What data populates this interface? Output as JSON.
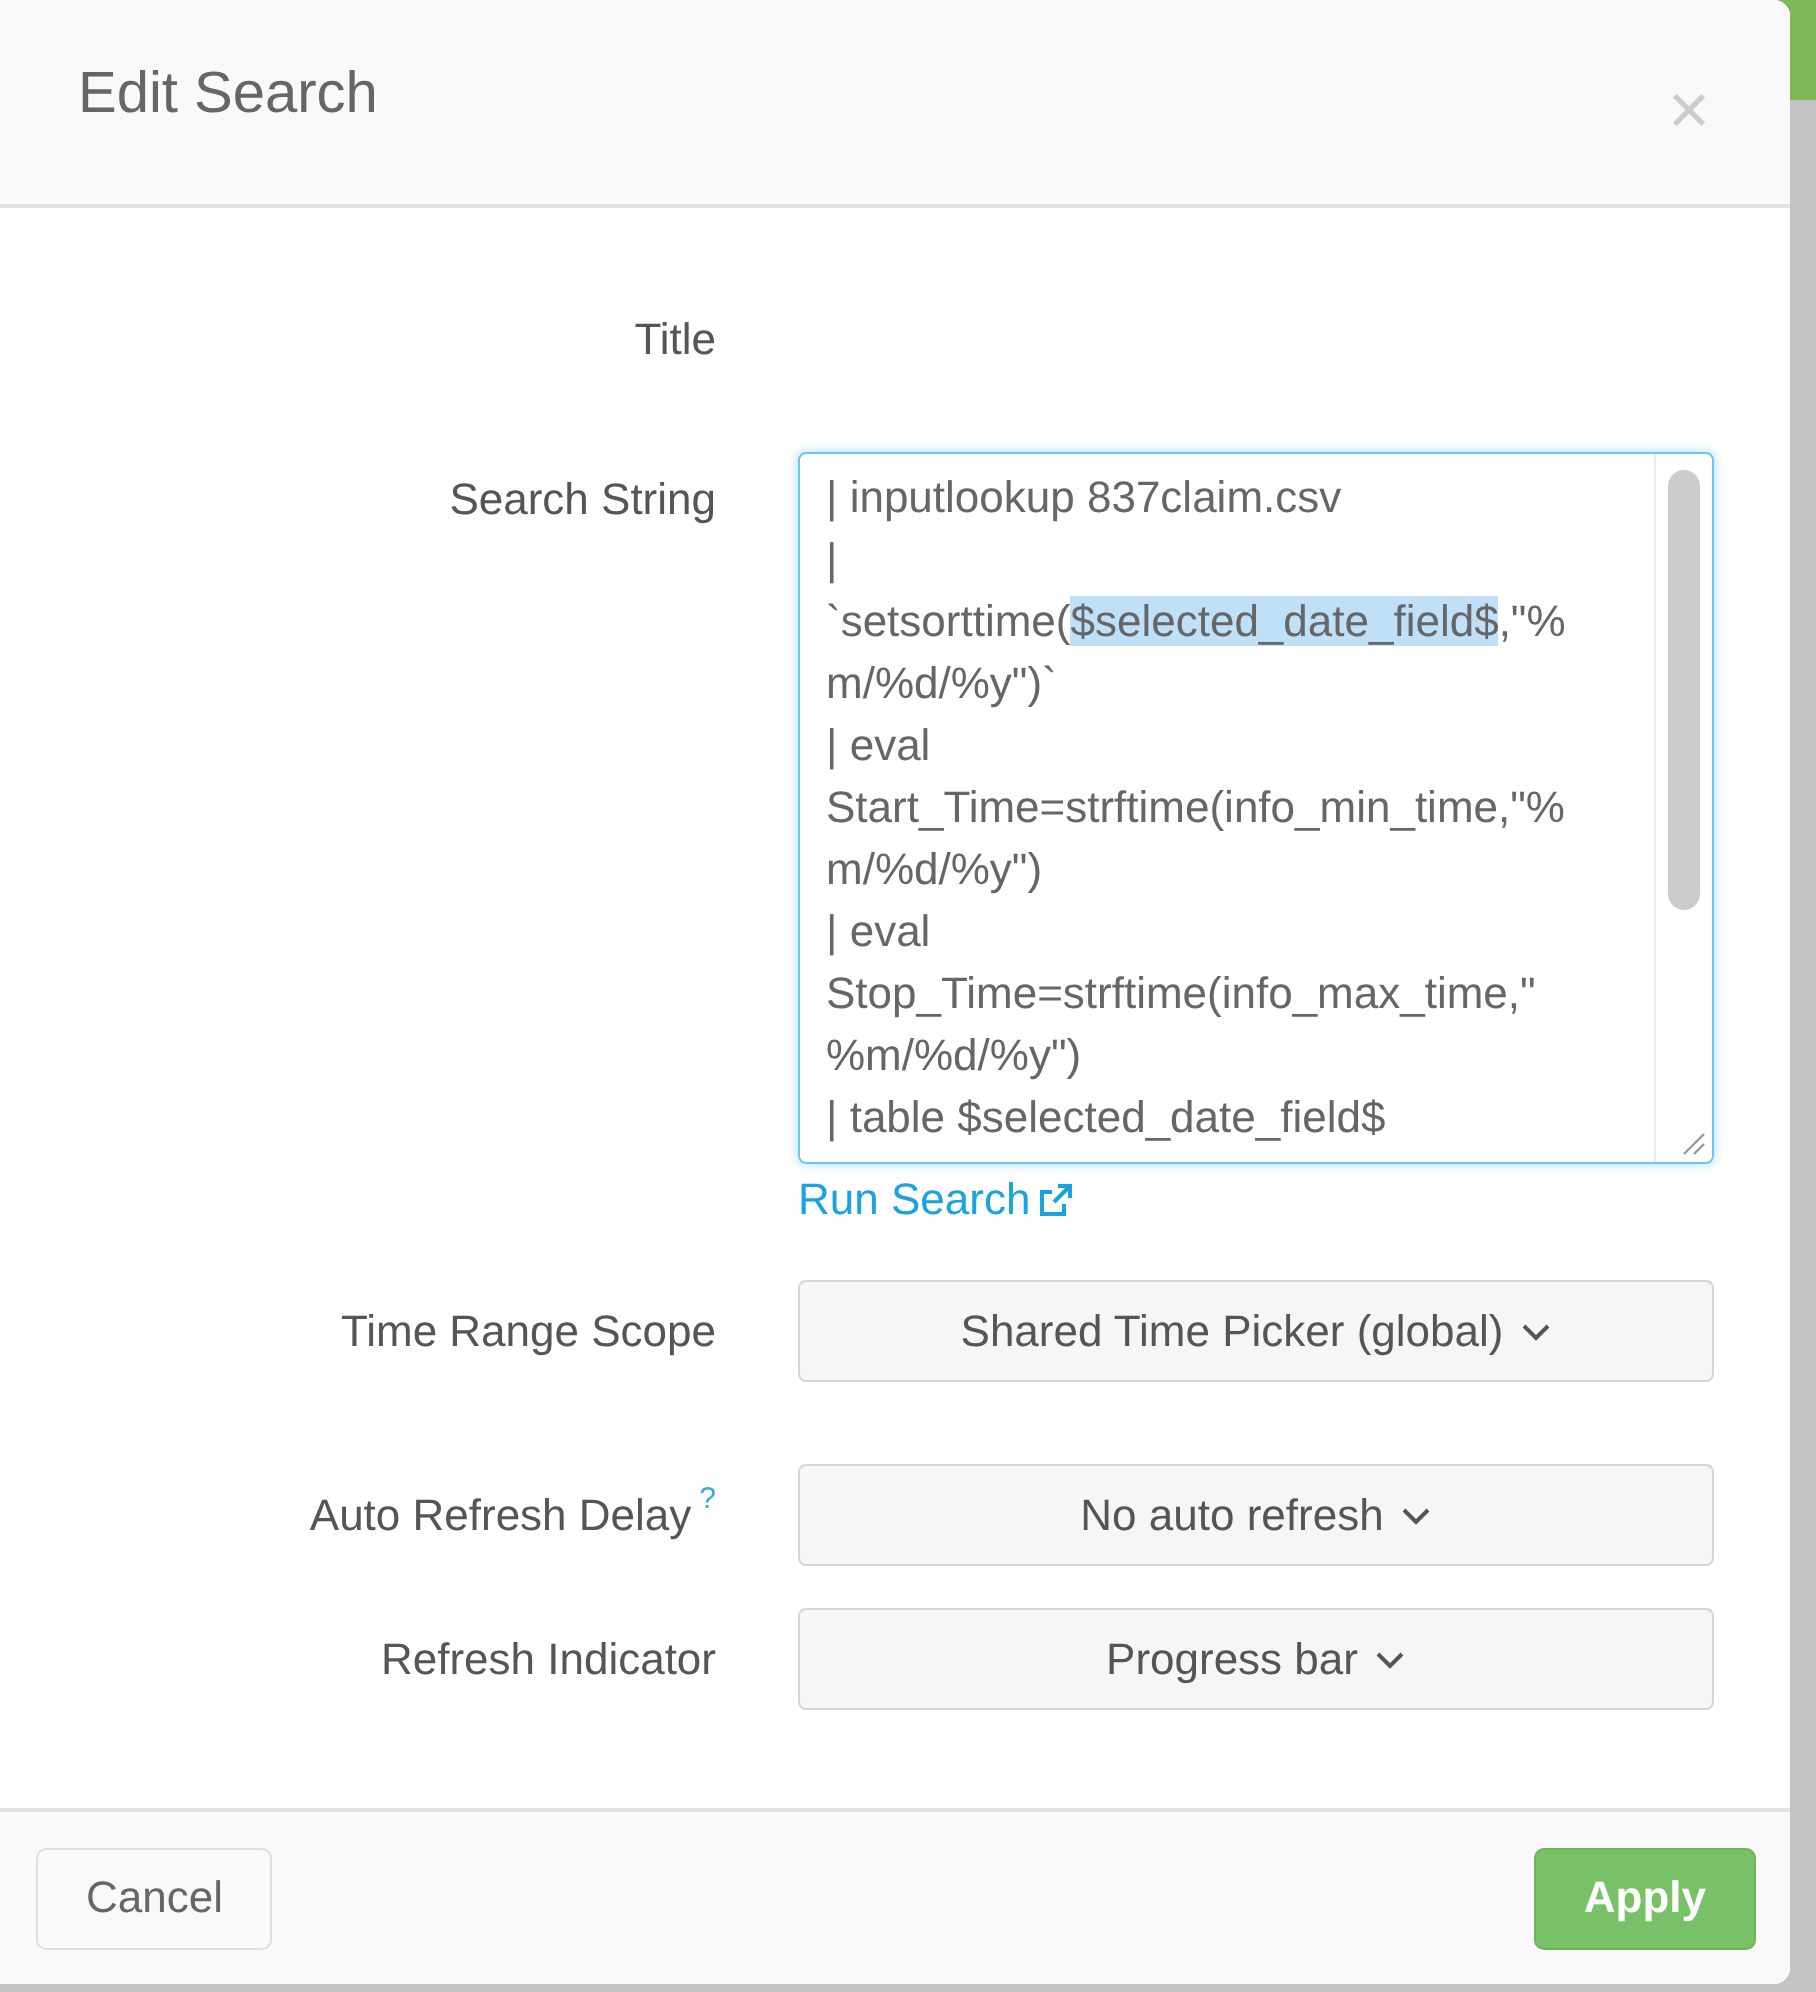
{
  "dialog": {
    "title": "Edit Search",
    "close": "×"
  },
  "fields": [
    {
      "kind": "label",
      "label": "Title"
    },
    {
      "kind": "search",
      "label": "Search String",
      "lines": [
        [
          {
            "text": "| inputlookup 837claim.csv",
            "selected": false
          }
        ],
        [
          {
            "text": "|",
            "selected": false
          }
        ],
        [
          {
            "text": "`setsorttime(",
            "selected": false
          },
          {
            "text": "$selected_date_field$",
            "selected": true
          },
          {
            "text": ",\"%",
            "selected": false
          }
        ],
        [
          {
            "text": "m/%d/%y\")`",
            "selected": false
          }
        ],
        [
          {
            "text": "| eval",
            "selected": false
          }
        ],
        [
          {
            "text": "Start_Time=strftime(info_min_time,\"%",
            "selected": false
          }
        ],
        [
          {
            "text": "m/%d/%y\")",
            "selected": false
          }
        ],
        [
          {
            "text": "| eval",
            "selected": false
          }
        ],
        [
          {
            "text": "Stop_Time=strftime(info_max_time,\"",
            "selected": false
          }
        ],
        [
          {
            "text": "%m/%d/%y\")",
            "selected": false
          }
        ],
        [
          {
            "text": "| table $selected_date_field$",
            "selected": false
          }
        ]
      ],
      "link": "Run Search"
    },
    {
      "kind": "select",
      "label": "Time Range Scope",
      "value": "Shared Time Picker (global)"
    },
    {
      "kind": "select",
      "label": "Auto Refresh Delay",
      "help": "?",
      "value": "No auto refresh"
    },
    {
      "kind": "select",
      "label": "Refresh Indicator",
      "value": "Progress bar"
    }
  ],
  "buttons": [
    {
      "label": "Cancel",
      "kind": "secondary"
    },
    {
      "label": "Apply",
      "kind": "primary"
    }
  ]
}
